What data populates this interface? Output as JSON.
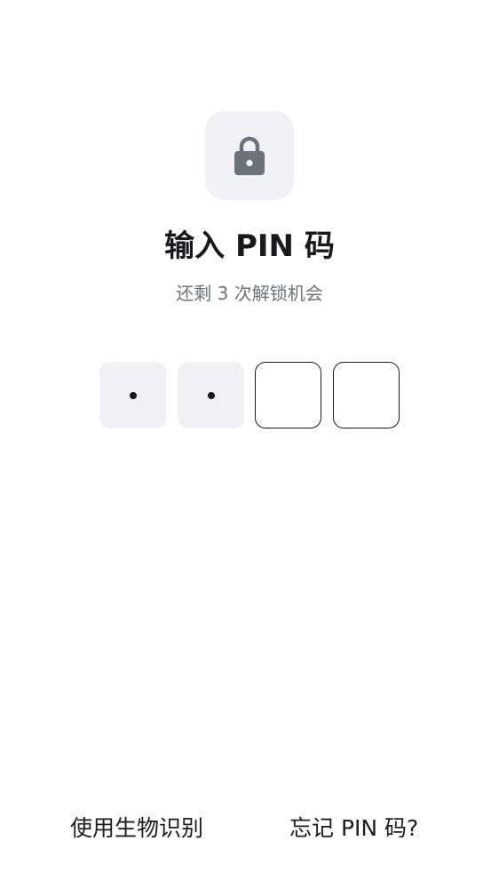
{
  "header": {
    "icon": "lock-icon",
    "title": "输入 PIN 码",
    "subtitle": "还剩 3 次解锁机会"
  },
  "pin": {
    "length": 4,
    "entered": 2
  },
  "footer": {
    "biometric_label": "使用生物识别",
    "forgot_label": "忘记 PIN 码?"
  },
  "colors": {
    "tile_background": "#f0f1f4",
    "icon": "#6b727c",
    "subtitle": "#6d727b",
    "text": "#1a1c20"
  }
}
